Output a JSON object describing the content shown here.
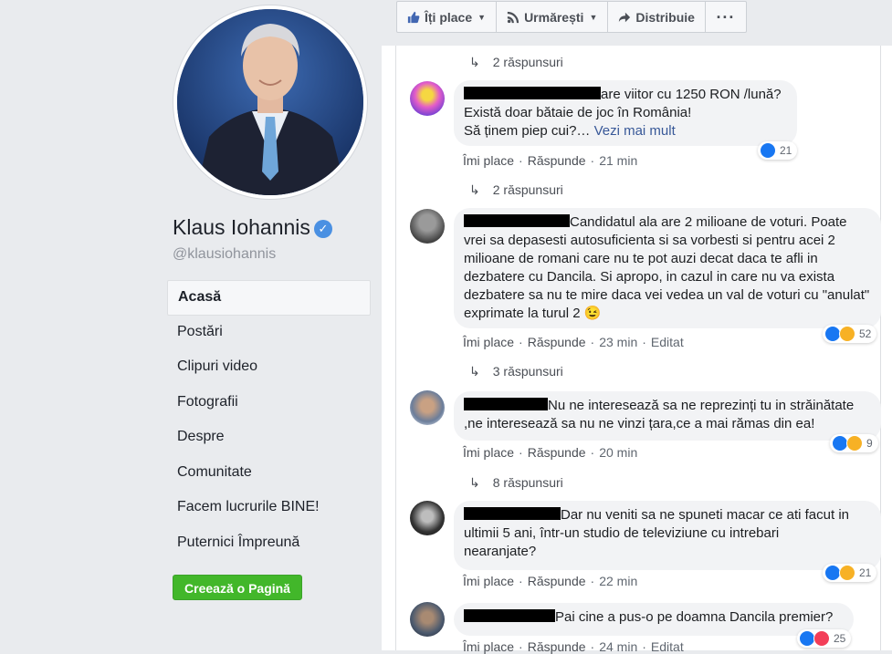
{
  "profile": {
    "name": "Klaus Iohannis",
    "handle": "@klausiohannis"
  },
  "nav": {
    "items": [
      {
        "label": "Acasă",
        "active": true
      },
      {
        "label": "Postări"
      },
      {
        "label": "Clipuri video"
      },
      {
        "label": "Fotografii"
      },
      {
        "label": "Despre"
      },
      {
        "label": "Comunitate"
      },
      {
        "label": "Facem lucrurile BINE!"
      },
      {
        "label": "Puternici Împreună"
      }
    ],
    "create_page": "Creează o Pagină"
  },
  "actions": {
    "like": "Îți place",
    "follow": "Urmărești",
    "share": "Distribuie",
    "more": "···"
  },
  "colors": {
    "accent": "#385898",
    "like_blue": "#1877f2",
    "create_green": "#42b72a"
  },
  "feed": {
    "replies_top": "2 răspunsuri",
    "comments": [
      {
        "text_line1": "are viitor cu 1250 RON /lună?",
        "text_line2": "Există doar bătaie de joc în România!",
        "text_line3": "Să ținem piep cui?…",
        "see_more": "Vezi mai mult",
        "like": "Îmi place",
        "reply": "Răspunde",
        "time": "21 min",
        "reactions": "21",
        "replies": "2 răspunsuri"
      },
      {
        "text": "Candidatul ala are 2 milioane de voturi. Poate vrei sa depasesti autosuficienta si sa vorbesti si pentru acei 2 milioane de romani care nu te pot auzi decat daca te afli in dezbatere cu Dancila. Si apropo, in cazul in care nu va exista dezbatere sa nu te mire daca vei vedea un val de voturi cu \"anulat\" exprimate la turul 2",
        "emoji": "😉",
        "like": "Îmi place",
        "reply": "Răspunde",
        "time": "23 min",
        "edited": "Editat",
        "reactions": "52",
        "replies": "3 răspunsuri"
      },
      {
        "text_line1": "Nu ne interesează sa ne reprezinți tu in străinătate",
        "text_line2": ",ne interesează sa nu ne vinzi țara,ce a mai rămas din ea!",
        "like": "Îmi place",
        "reply": "Răspunde",
        "time": "20 min",
        "reactions": "9",
        "replies": "8 răspunsuri"
      },
      {
        "text_line1": "Dar nu veniti sa ne spuneti macar ce ati facut in",
        "text_line2": "ultimii 5 ani, într-un studio de televiziune cu intrebari",
        "text_line3": "nearanjate?",
        "like": "Îmi place",
        "reply": "Răspunde",
        "time": "22 min",
        "reactions": "21"
      },
      {
        "text": "Pai cine a pus-o pe doamna Dancila premier?",
        "like": "Îmi place",
        "reply": "Răspunde",
        "time": "24 min",
        "edited": "Editat",
        "reactions": "25"
      }
    ]
  }
}
